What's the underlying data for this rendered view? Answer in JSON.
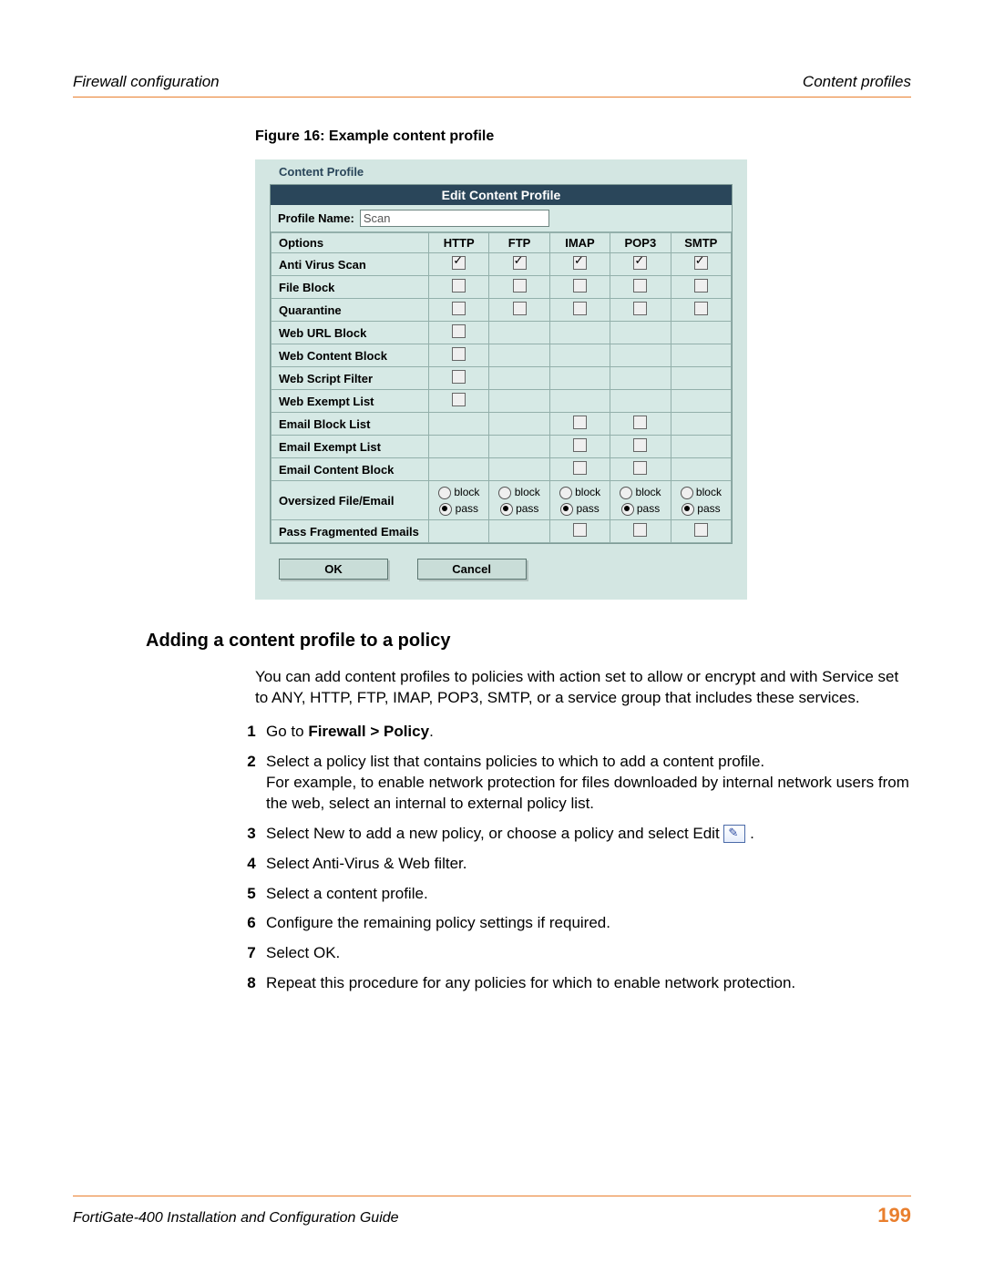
{
  "header": {
    "left": "Firewall configuration",
    "right": "Content profiles"
  },
  "figure_caption": "Figure 16: Example content profile",
  "shot": {
    "tab": "Content Profile",
    "title_bar": "Edit Content Profile",
    "profile_name_label": "Profile Name:",
    "profile_name_value": "Scan",
    "cols_header": "Options",
    "cols": [
      "HTTP",
      "FTP",
      "IMAP",
      "POP3",
      "SMTP"
    ],
    "rows": [
      {
        "label": "Anti Virus Scan",
        "cells": [
          "chk:1",
          "chk:1",
          "chk:1",
          "chk:1",
          "chk:1"
        ]
      },
      {
        "label": "File Block",
        "cells": [
          "chk:0",
          "chk:0",
          "chk:0",
          "chk:0",
          "chk:0"
        ]
      },
      {
        "label": "Quarantine",
        "cells": [
          "chk:0",
          "chk:0",
          "chk:0",
          "chk:0",
          "chk:0"
        ]
      },
      {
        "label": "Web URL Block",
        "cells": [
          "chk:0",
          "",
          "",
          "",
          ""
        ]
      },
      {
        "label": "Web Content Block",
        "cells": [
          "chk:0",
          "",
          "",
          "",
          ""
        ]
      },
      {
        "label": "Web Script Filter",
        "cells": [
          "chk:0",
          "",
          "",
          "",
          ""
        ]
      },
      {
        "label": "Web Exempt List",
        "cells": [
          "chk:0",
          "",
          "",
          "",
          ""
        ]
      },
      {
        "label": "Email Block List",
        "cells": [
          "",
          "",
          "chk:0",
          "chk:0",
          ""
        ]
      },
      {
        "label": "Email Exempt List",
        "cells": [
          "",
          "",
          "chk:0",
          "chk:0",
          ""
        ]
      },
      {
        "label": "Email Content Block",
        "cells": [
          "",
          "",
          "chk:0",
          "chk:0",
          ""
        ]
      },
      {
        "label": "Oversized File/Email",
        "cells": [
          "radio",
          "radio",
          "radio",
          "radio",
          "radio"
        ]
      },
      {
        "label": "Pass Fragmented Emails",
        "cells": [
          "",
          "",
          "chk:0",
          "chk:0",
          "chk:0"
        ]
      }
    ],
    "radio_block": "block",
    "radio_pass": "pass",
    "ok": "OK",
    "cancel": "Cancel"
  },
  "section_heading": "Adding a content profile to a policy",
  "intro": "You can add content profiles to policies with action set to allow or encrypt and with Service set to ANY, HTTP, FTP, IMAP, POP3, SMTP, or a service group that includes these services.",
  "steps": [
    {
      "n": "1",
      "pre": "Go to ",
      "bold": "Firewall > Policy",
      "post": "."
    },
    {
      "n": "2",
      "text": "Select a policy list that contains policies to which to add a content profile.",
      "cont": "For example, to enable network protection for files downloaded by internal network users from the web, select an internal to external policy list."
    },
    {
      "n": "3",
      "text_pre": "Select New to add a new policy, or choose a policy and select Edit ",
      "icon": true,
      "text_post": " ."
    },
    {
      "n": "4",
      "text": "Select Anti-Virus & Web filter."
    },
    {
      "n": "5",
      "text": "Select a content profile."
    },
    {
      "n": "6",
      "text": "Configure the remaining policy settings if required."
    },
    {
      "n": "7",
      "text": "Select OK."
    },
    {
      "n": "8",
      "text": "Repeat this procedure for any policies for which to enable network protection."
    }
  ],
  "footer": {
    "left": "FortiGate-400 Installation and Configuration Guide",
    "right": "199"
  }
}
